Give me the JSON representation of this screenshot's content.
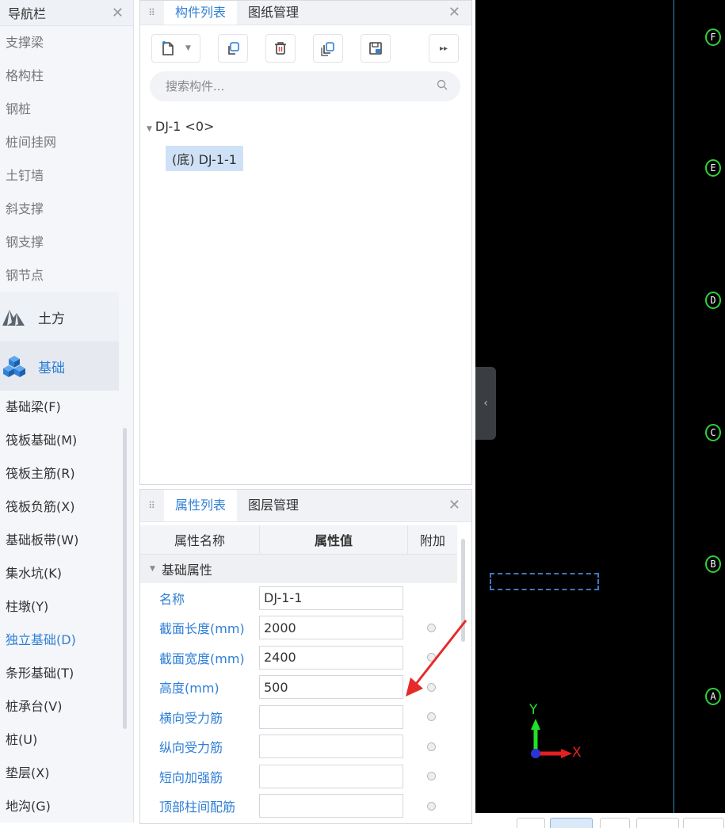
{
  "nav": {
    "title": "导航栏",
    "items": [
      "支撑梁",
      "格构柱",
      "钢桩",
      "桩间挂网",
      "土钉墙",
      "斜支撑",
      "钢支撑",
      "钢节点"
    ],
    "categories": [
      {
        "label": "土方",
        "icon": "earthwork-icon"
      },
      {
        "label": "基础",
        "icon": "foundation-icon"
      }
    ],
    "sub_items": [
      "基础梁(F)",
      "筏板基础(M)",
      "筏板主筋(R)",
      "筏板负筋(X)",
      "基础板带(W)",
      "集水坑(K)",
      "柱墩(Y)",
      "独立基础(D)",
      "条形基础(T)",
      "桩承台(V)",
      "桩(U)",
      "垫层(X)",
      "地沟(G)"
    ],
    "active_sub": "独立基础(D)"
  },
  "component_panel": {
    "tabs": [
      "构件列表",
      "图纸管理"
    ],
    "active_tab": "构件列表",
    "search_placeholder": "搜索构件...",
    "tree": {
      "node": "DJ-1 <0>",
      "leaf": "(底) DJ-1-1"
    }
  },
  "property_panel": {
    "tabs": [
      "属性列表",
      "图层管理"
    ],
    "active_tab": "属性列表",
    "headers": [
      "属性名称",
      "属性值",
      "附加"
    ],
    "group": "基础属性",
    "rows": [
      {
        "name": "名称",
        "value": ""
      },
      {
        "name": "截面长度(mm)",
        "value": "2000"
      },
      {
        "name": "截面宽度(mm)",
        "value": "2400"
      },
      {
        "name": "高度(mm)",
        "value": "500"
      },
      {
        "name": "横向受力筋",
        "value": ""
      },
      {
        "name": "纵向受力筋",
        "value": ""
      },
      {
        "name": "短向加强筋",
        "value": ""
      },
      {
        "name": "顶部柱间配筋",
        "value": ""
      }
    ],
    "name_value": "DJ-1-1"
  },
  "canvas": {
    "axis_labels": [
      "F",
      "E",
      "D",
      "C",
      "B",
      "A"
    ],
    "x_axis": "X",
    "y_axis": "Y",
    "colors": {
      "background": "#000000",
      "axis_bubble": "#2fd23a",
      "grid_line": "#2a8fb3",
      "y_arrow": "#22e02a",
      "x_arrow": "#e22020"
    }
  }
}
